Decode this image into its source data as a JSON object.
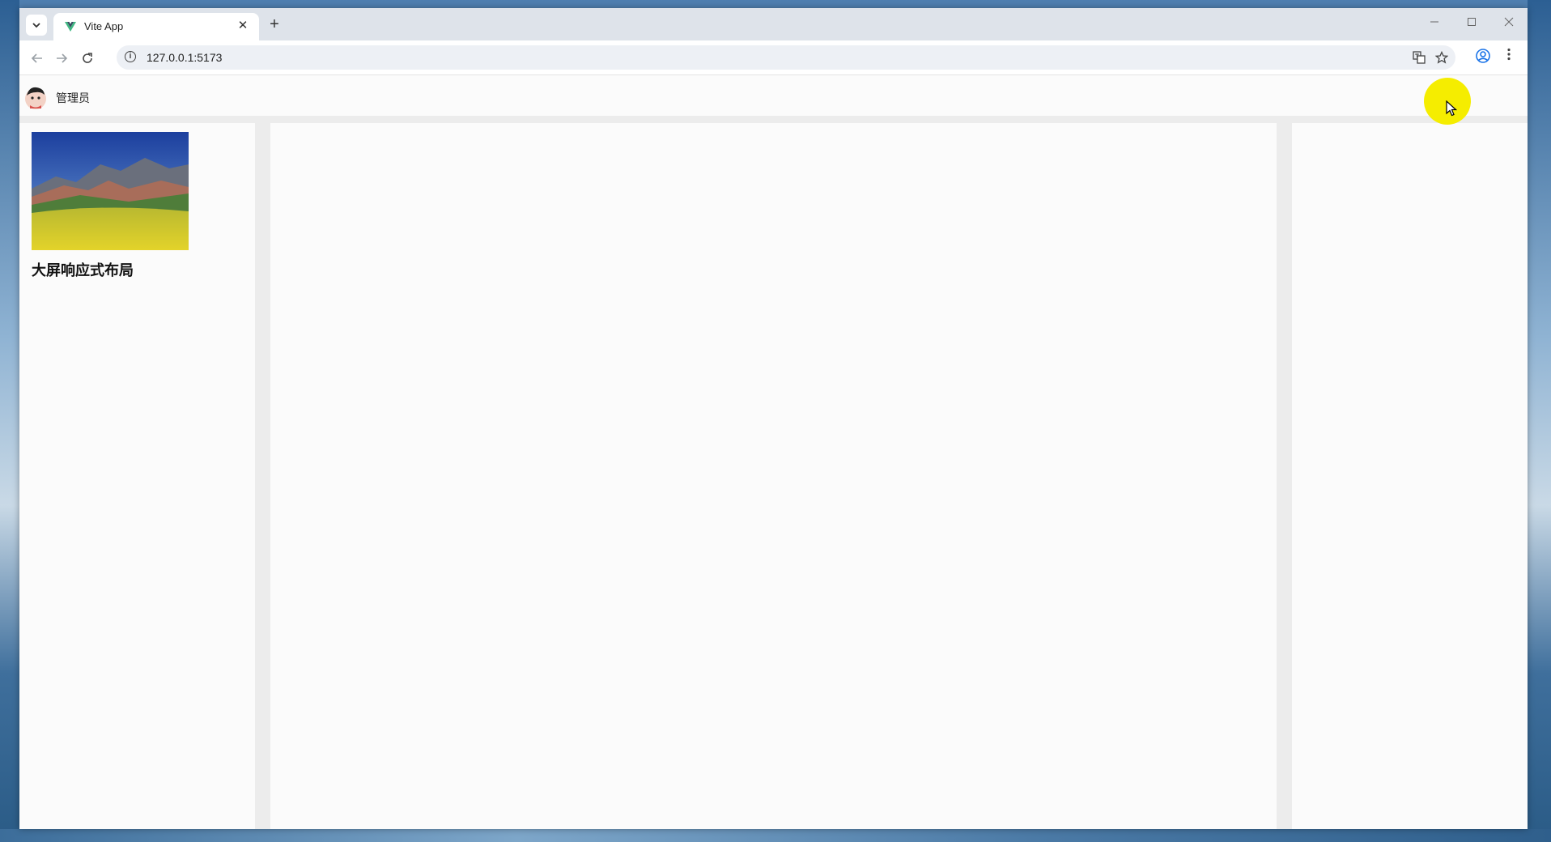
{
  "browser": {
    "tab_title": "Vite App",
    "tab_close": "✕",
    "new_tab": "+",
    "url": "127.0.0.1:5173"
  },
  "app": {
    "user_name": "管理员",
    "card_title": "大屏响应式布局"
  },
  "icons": {
    "tab_search": "chevron-down-icon",
    "favicon": "vue-logo-icon",
    "back": "arrow-left-icon",
    "forward": "arrow-right-icon",
    "reload": "reload-icon",
    "site_info": "info-icon",
    "translate": "translate-icon",
    "bookmark": "star-icon",
    "profile": "profile-icon",
    "menu": "more-vert-icon",
    "minimize": "minimize-icon",
    "maximize": "maximize-icon",
    "close": "close-icon"
  },
  "colors": {
    "tabstrip": "#dee3ea",
    "cursor_highlight": "#f5ed00",
    "vue_green": "#41b883",
    "vue_dark": "#35495e"
  }
}
